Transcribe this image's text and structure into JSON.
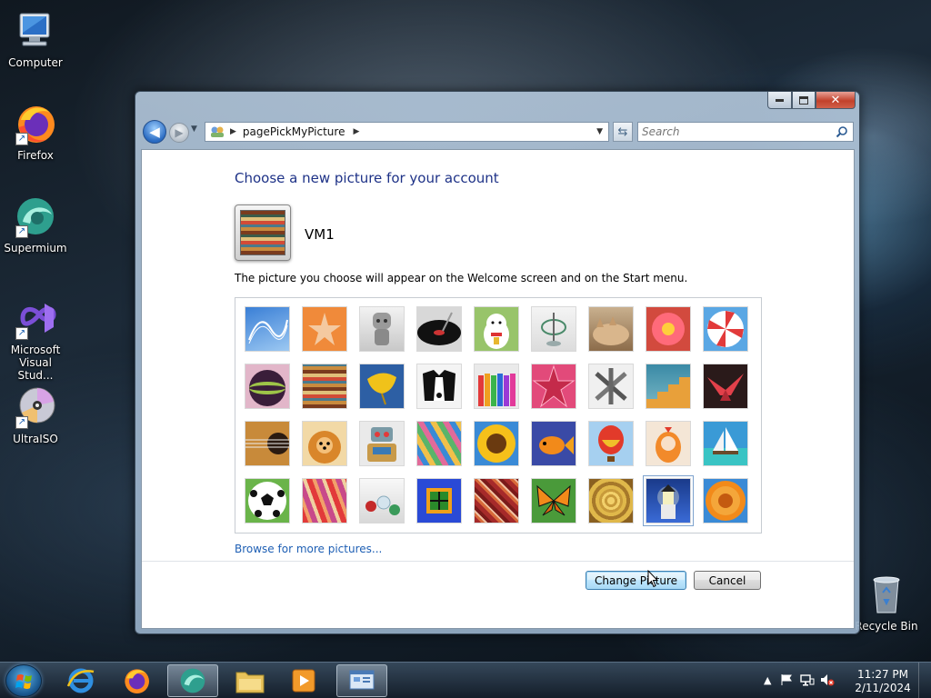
{
  "desktop": {
    "icons": [
      {
        "label": "Computer"
      },
      {
        "label": "Firefox"
      },
      {
        "label": "Supermium"
      },
      {
        "label": "Microsoft\nVisual Stud..."
      },
      {
        "label": "UltraISO"
      },
      {
        "label": "Recycle Bin"
      }
    ]
  },
  "window": {
    "address": "pagePickMyPicture",
    "search_placeholder": "Search",
    "heading": "Choose a new picture for your account",
    "username": "VM1",
    "description": "The picture you choose will appear on the Welcome screen and on the Start menu.",
    "browse_link": "Browse for more pictures...",
    "buttons": {
      "change": "Change Picture",
      "cancel": "Cancel"
    },
    "pictures": [
      "roller-coaster",
      "starfish",
      "robot-toy",
      "turntable",
      "lucky-cat",
      "gyroscope",
      "sleeping-kitten",
      "pink-flower",
      "pinwheel",
      "soccer-ball-purple",
      "fabric-stripes",
      "ginkgo-leaf",
      "border-collie",
      "crayons",
      "star-lantern",
      "jacks",
      "stairs",
      "origami-crane",
      "guitar",
      "pomeranian",
      "tin-robot",
      "silk-scarves",
      "sunflower",
      "goldfish",
      "hot-air-balloon",
      "doll-figure",
      "sailboat",
      "soccer-ball",
      "fabric-red",
      "marbles",
      "green-window",
      "woven-textile",
      "butterfly",
      "wicker-basket",
      "lighthouse",
      "orange-daisy"
    ],
    "selected_picture": "lighthouse"
  },
  "taskbar": {
    "apps": [
      "internet-explorer",
      "firefox",
      "supermium",
      "file-explorer",
      "media-player",
      "control-panel"
    ],
    "time": "11:27 PM",
    "date": "2/11/2024"
  }
}
